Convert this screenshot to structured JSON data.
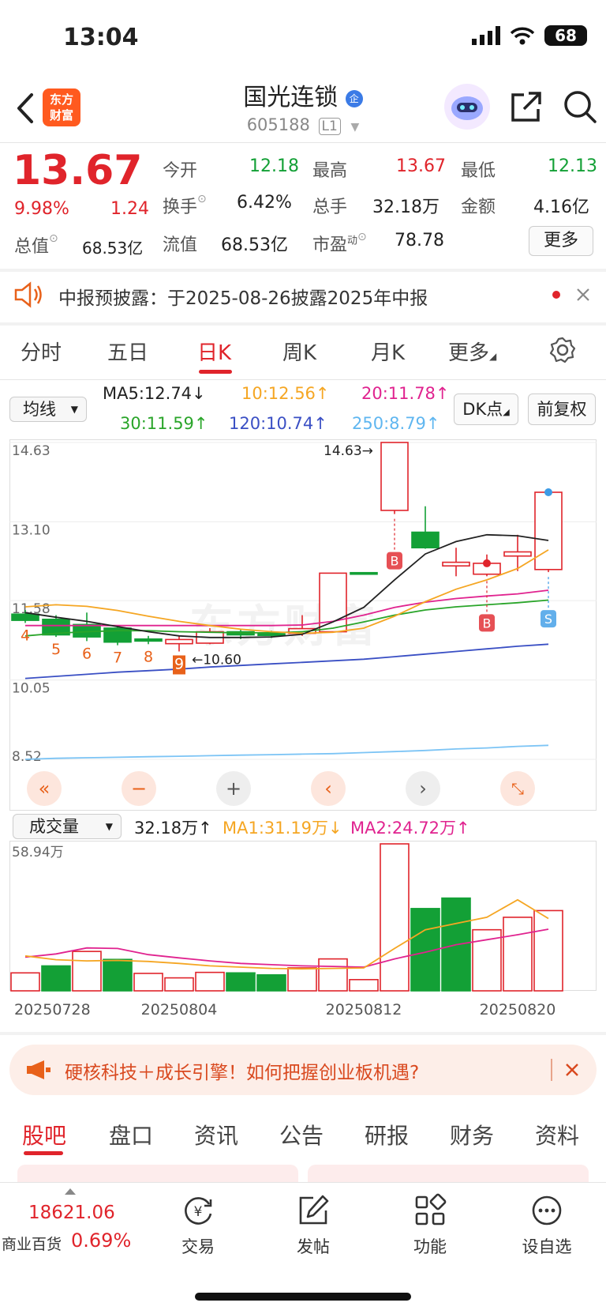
{
  "status_bar": {
    "time": "13:04",
    "battery": "68"
  },
  "header": {
    "logo_line1": "东方",
    "logo_line2": "财富",
    "stock_name": "国光连锁",
    "stock_code": "605188",
    "level": "L1"
  },
  "quote": {
    "price": "13.67",
    "change_pct": "9.98%",
    "change_amt": "1.24",
    "total_value_label": "总值",
    "total_value": "68.53亿",
    "open_label": "今开",
    "open": "12.18",
    "high_label": "最高",
    "high": "13.67",
    "low_label": "最低",
    "low": "12.13",
    "turnover_label": "换手",
    "turnover": "6.42%",
    "volume_label": "总手",
    "volume": "32.18万",
    "amount_label": "金额",
    "amount": "4.16亿",
    "float_label": "流值",
    "float_value": "68.53亿",
    "pe_label": "市盈",
    "pe_sup": "动",
    "pe": "78.78",
    "more_label": "更多"
  },
  "notice": {
    "text": "中报预披露：于2025-08-26披露2025年中报"
  },
  "k_tabs": [
    "分时",
    "五日",
    "日K",
    "周K",
    "月K",
    "更多"
  ],
  "ma_row": {
    "select": "均线",
    "ma5": "MA5:12.74↓",
    "ma10": "10:12.56↑",
    "ma20": "20:11.78↑",
    "ma30": "30:11.59↑",
    "ma120": "120:10.74↑",
    "ma250": "250:8.79↑",
    "dk_label": "DK点",
    "fq_label": "前复权"
  },
  "colors": {
    "up": "#e0242b",
    "down": "#13a036",
    "ma5": "#222222",
    "ma10": "#f5a623",
    "ma20": "#e0238f",
    "ma30": "#2aa52a",
    "ma120": "#3a4fc4",
    "ma250": "#7cc4f5"
  },
  "chart_data": [
    {
      "type": "candlestick",
      "y_ticks": [
        "14.63",
        "13.10",
        "11.58",
        "10.05",
        "8.52"
      ],
      "ylim": [
        8.52,
        14.63
      ],
      "annotations": {
        "high_marker": "14.63→",
        "low_marker": "←10.60",
        "seq": [
          "4",
          "5",
          "6",
          "7",
          "8",
          "9"
        ],
        "signals": [
          "B",
          "B",
          "S"
        ]
      },
      "candles": [
        {
          "o": 11.32,
          "c": 11.2,
          "h": 11.4,
          "l": 11.15
        },
        {
          "o": 11.22,
          "c": 10.92,
          "h": 11.3,
          "l": 10.88
        },
        {
          "o": 11.12,
          "c": 10.88,
          "h": 11.35,
          "l": 10.8
        },
        {
          "o": 11.05,
          "c": 10.78,
          "h": 11.1,
          "l": 10.72
        },
        {
          "o": 10.84,
          "c": 10.8,
          "h": 10.9,
          "l": 10.74
        },
        {
          "o": 10.75,
          "c": 10.83,
          "h": 10.9,
          "l": 10.6
        },
        {
          "o": 10.76,
          "c": 10.98,
          "h": 11.05,
          "l": 10.74
        },
        {
          "o": 10.98,
          "c": 10.92,
          "h": 11.04,
          "l": 10.84
        },
        {
          "o": 10.94,
          "c": 10.91,
          "h": 11.0,
          "l": 10.86
        },
        {
          "o": 10.95,
          "c": 11.04,
          "h": 11.3,
          "l": 10.9
        },
        {
          "o": 10.98,
          "c": 12.11,
          "h": 12.11,
          "l": 10.96
        },
        {
          "o": 12.12,
          "c": 12.1,
          "h": 12.13,
          "l": 12.08
        },
        {
          "o": 13.32,
          "c": 14.63,
          "h": 14.63,
          "l": 13.25
        },
        {
          "o": 12.9,
          "c": 12.6,
          "h": 13.4,
          "l": 12.58
        },
        {
          "o": 12.25,
          "c": 12.32,
          "h": 12.6,
          "l": 12.05
        },
        {
          "o": 12.09,
          "c": 12.3,
          "h": 12.47,
          "l": 12.05
        },
        {
          "o": 12.44,
          "c": 12.52,
          "h": 12.85,
          "l": 12.15
        },
        {
          "o": 12.18,
          "c": 13.67,
          "h": 13.67,
          "l": 12.13
        }
      ],
      "ma5": [
        11.35,
        11.26,
        11.18,
        11.08,
        10.98,
        10.9,
        10.87,
        10.87,
        10.88,
        10.93,
        11.17,
        11.45,
        11.98,
        12.48,
        12.72,
        12.85,
        12.83,
        12.74
      ],
      "ma10": [
        11.46,
        11.5,
        11.47,
        11.39,
        11.28,
        11.18,
        11.1,
        11.03,
        10.98,
        10.95,
        10.97,
        11.05,
        11.28,
        11.56,
        11.8,
        11.98,
        12.2,
        12.56
      ],
      "ma20": [
        11.1,
        11.1,
        11.1,
        11.1,
        11.1,
        11.1,
        11.1,
        11.1,
        11.1,
        11.11,
        11.18,
        11.3,
        11.45,
        11.55,
        11.62,
        11.67,
        11.71,
        11.78
      ],
      "ma30": [
        10.9,
        10.95,
        10.98,
        11.0,
        11.0,
        10.98,
        10.97,
        10.96,
        10.96,
        10.98,
        11.05,
        11.17,
        11.3,
        11.4,
        11.46,
        11.5,
        11.54,
        11.59
      ],
      "ma120": [
        10.08,
        10.12,
        10.16,
        10.2,
        10.23,
        10.26,
        10.3,
        10.33,
        10.36,
        10.39,
        10.42,
        10.45,
        10.5,
        10.55,
        10.6,
        10.65,
        10.7,
        10.74
      ],
      "ma250": [
        8.52,
        8.54,
        8.55,
        8.56,
        8.57,
        8.58,
        8.59,
        8.6,
        8.61,
        8.62,
        8.63,
        8.65,
        8.67,
        8.69,
        8.72,
        8.74,
        8.77,
        8.79
      ]
    },
    {
      "type": "bar",
      "title": "成交量",
      "y_ticks": [
        "58.94万"
      ],
      "ylim": [
        0,
        58.94
      ],
      "x_labels": [
        "20250728",
        "20250804",
        "20250812",
        "20250820"
      ],
      "volumes": [
        7.2,
        10.0,
        15.8,
        12.6,
        7.0,
        5.2,
        7.4,
        7.2,
        6.4,
        9.2,
        12.8,
        4.5,
        58.94,
        33.0,
        37.2,
        24.5,
        29.5,
        32.18
      ],
      "directions": [
        "up",
        "down",
        "up",
        "down",
        "up",
        "up",
        "up",
        "down",
        "down",
        "up",
        "up",
        "up",
        "up",
        "down",
        "down",
        "up",
        "up",
        "up"
      ],
      "ma1": [
        14.0,
        12.5,
        12.0,
        12.2,
        11.8,
        11.0,
        10.0,
        9.5,
        9.0,
        8.8,
        9.0,
        9.2,
        17.0,
        24.5,
        27.0,
        29.5,
        36.5,
        29.0
      ],
      "ma2": [
        13.5,
        14.8,
        17.2,
        17.0,
        14.5,
        13.2,
        12.0,
        11.0,
        10.5,
        10.0,
        9.8,
        9.5,
        12.8,
        15.5,
        18.5,
        20.5,
        22.5,
        24.72
      ]
    }
  ],
  "volume_row": {
    "select": "成交量",
    "total": "32.18万↑",
    "ma1": "MA1:31.19万↓",
    "ma2": "MA2:24.72万↑"
  },
  "watermark": "东方财富",
  "ad": {
    "text": "硬核科技＋成长引擎！如何把握创业板机遇?"
  },
  "bottom_tabs": [
    "股吧",
    "盘口",
    "资讯",
    "公告",
    "研报",
    "财务",
    "资料"
  ],
  "index_info": {
    "value": "18621.06",
    "name": "商业百货",
    "pct": "0.69%"
  },
  "nav": {
    "trade": "交易",
    "post": "发帖",
    "function": "功能",
    "watch": "设自选"
  }
}
